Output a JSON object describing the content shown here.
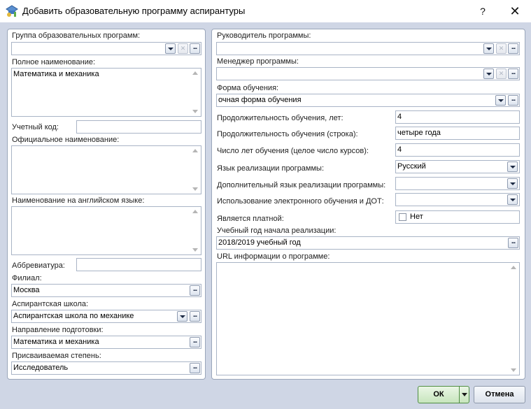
{
  "window": {
    "title": "Добавить образовательную программу аспирантуры",
    "help_label": "?",
    "close_label": "✕"
  },
  "left": {
    "group_label": "Группа образовательных программ:",
    "group_value": "",
    "full_name_label": "Полное наименование:",
    "full_name_value": "Математика и механика",
    "account_code_label": "Учетный код:",
    "account_code_value": "",
    "official_name_label": "Официальное наименование:",
    "official_name_value": "",
    "english_name_label": "Наименование на английском языке:",
    "english_name_value": "",
    "abbreviation_label": "Аббревиатура:",
    "abbreviation_value": "",
    "branch_label": "Филиал:",
    "branch_value": "Москва",
    "school_label": "Аспирантская школа:",
    "school_value": "Аспирантская школа по механике",
    "direction_label": "Направление подготовки:",
    "direction_value": "Математика и механика",
    "degree_label": "Присваиваемая степень:",
    "degree_value": "Исследователь"
  },
  "right": {
    "head_label": "Руководитель программы:",
    "head_value": "",
    "manager_label": "Менеджер программы:",
    "manager_value": "",
    "form_label": "Форма обучения:",
    "form_value": "очная форма обучения",
    "duration_years_label": "Продолжительность обучения, лет:",
    "duration_years_value": "4",
    "duration_text_label": "Продолжительность обучения (строка):",
    "duration_text_value": "четыре года",
    "years_count_label": "Число лет обучения (целое число курсов):",
    "years_count_value": "4",
    "language_label": "Язык реализации программы:",
    "language_value": "Русский",
    "extra_language_label": "Дополнительный язык реализации программы:",
    "extra_language_value": "",
    "elearning_label": "Использование электронного обучения и ДОТ:",
    "elearning_value": "",
    "paid_label": "Является платной:",
    "paid_checkbox_label": "Нет",
    "paid_checked": false,
    "start_year_label": "Учебный год начала реализации:",
    "start_year_value": "2018/2019 учебный год",
    "url_label": "URL информации о программе:",
    "url_value": ""
  },
  "buttons": {
    "ok_label": "ОК",
    "cancel_label": "Отмена"
  },
  "icons": {
    "dropdown": "dropdown-arrow-icon",
    "clear": "clear-icon",
    "ellipsis": "ellipsis-icon",
    "app": "app-icon"
  }
}
